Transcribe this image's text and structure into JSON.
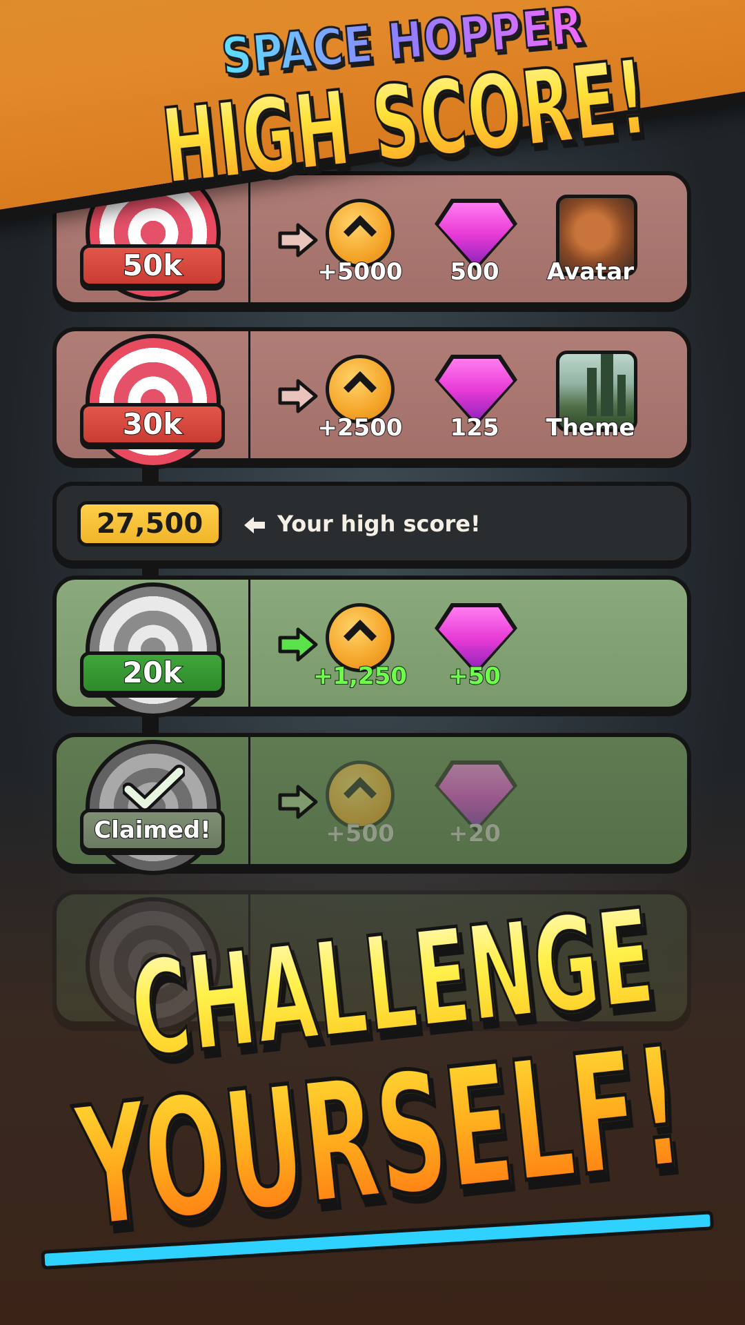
{
  "title": {
    "line1": "SPACE HOPPER",
    "line2": "HIGH SCORE!"
  },
  "tiers": [
    {
      "threshold": "50k",
      "rewards": {
        "coins": "+5000",
        "gems": "500",
        "item": "Avatar"
      }
    },
    {
      "threshold": "30k",
      "rewards": {
        "coins": "+2500",
        "gems": "125",
        "item": "Theme"
      }
    },
    {
      "threshold": "20k",
      "rewards": {
        "coins": "+1,250",
        "gems": "+50"
      }
    },
    {
      "threshold": "Claimed!",
      "rewards": {
        "coins": "+500",
        "gems": "+20"
      }
    }
  ],
  "current": {
    "score": "27,500",
    "note": "Your high score!"
  },
  "tagline": {
    "line1": "CHALLENGE",
    "line2": "YOURSELF!"
  },
  "colors": {
    "banner": "#e2892a",
    "accent_cyan": "#2fd1ff",
    "gold": "#ffcf4a",
    "green_plus": "#6dff4a"
  }
}
